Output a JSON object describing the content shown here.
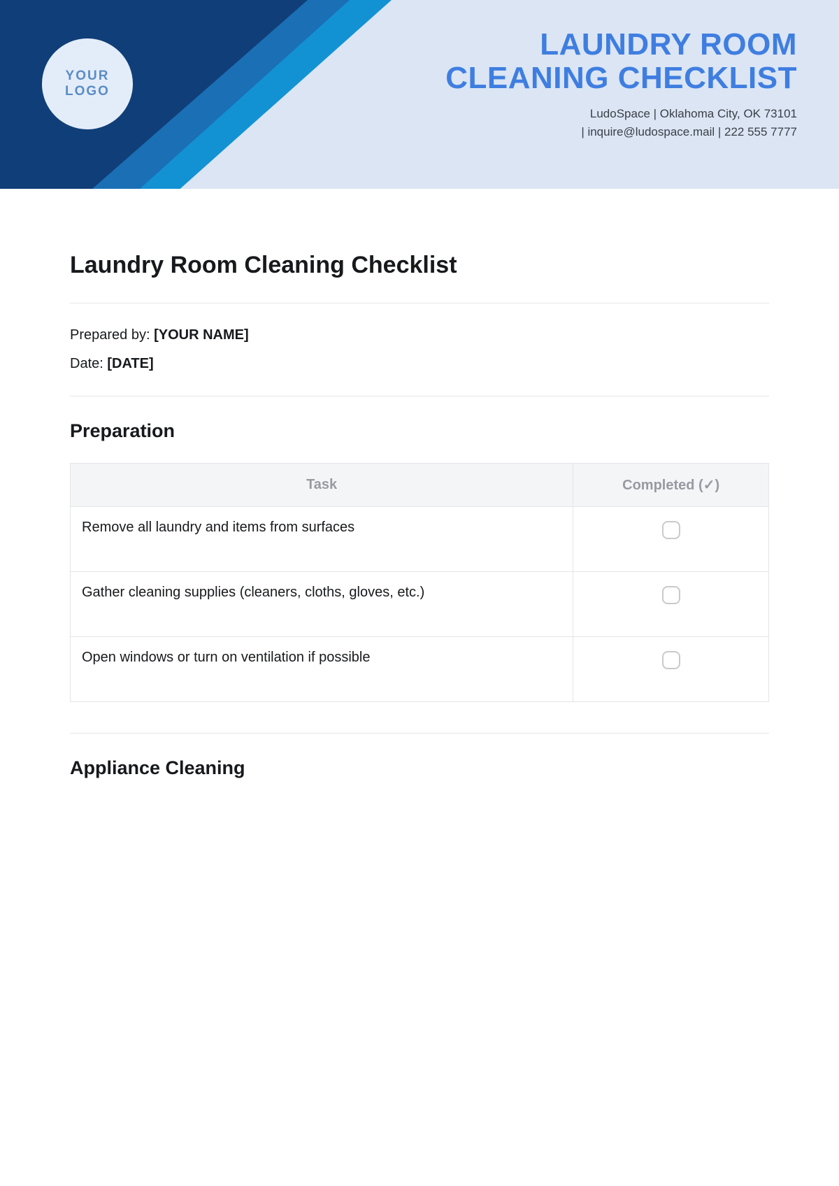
{
  "header": {
    "logo_line1": "YOUR",
    "logo_line2": "LOGO",
    "title_line1": "LAUNDRY ROOM",
    "title_line2": "CLEANING CHECKLIST",
    "contact_line1": "LudoSpace |  Oklahoma City, OK 73101",
    "contact_line2": "|  inquire@ludospace.mail | 222 555 7777"
  },
  "body": {
    "doc_title": "Laundry Room Cleaning Checklist",
    "prepared_label": "Prepared by: ",
    "prepared_value": "[YOUR NAME]",
    "date_label": "Date: ",
    "date_value": "[DATE]"
  },
  "table_headers": {
    "task": "Task",
    "completed": "Completed (✓)"
  },
  "sections": [
    {
      "title": "Preparation",
      "tasks": [
        "Remove all laundry and items from surfaces",
        "Gather cleaning supplies (cleaners, cloths, gloves, etc.)",
        "Open windows or turn on ventilation if possible"
      ]
    },
    {
      "title": "Appliance Cleaning",
      "tasks": []
    }
  ]
}
